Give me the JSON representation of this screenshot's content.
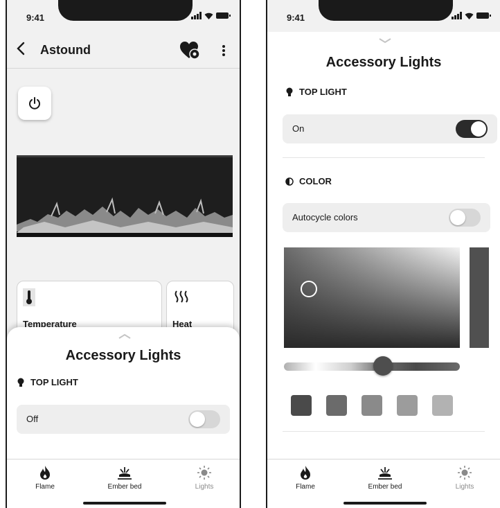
{
  "left_screen": {
    "status_time": "9:41",
    "device_name": "Astound",
    "cards": [
      {
        "label": "Temperature",
        "icon": "thermometer-icon"
      },
      {
        "label": "Heat",
        "icon": "heat-waves-icon"
      }
    ],
    "sheet": {
      "title": "Accessory Lights",
      "top_light_section": "TOP LIGHT",
      "top_light_row_label": "Off",
      "top_light_on": false
    }
  },
  "right_screen": {
    "status_time": "9:41",
    "title": "Accessory Lights",
    "top_light_section": "TOP LIGHT",
    "top_light_row_label": "On",
    "top_light_on": true,
    "color_section": "COLOR",
    "autocycle_label": "Autocycle colors",
    "autocycle_on": false,
    "preset_swatch_colors": [
      "#4a4a4a",
      "#6b6b6b",
      "#8a8a8a",
      "#9c9c9c",
      "#b2b2b2"
    ]
  },
  "tab_bar": {
    "tabs": [
      {
        "label": "Flame",
        "icon": "flame-icon"
      },
      {
        "label": "Ember bed",
        "icon": "ember-bed-icon"
      },
      {
        "label": "Lights",
        "icon": "sun-icon"
      }
    ]
  },
  "colors": {
    "background": "#f1f1f1",
    "surface": "#ffffff",
    "row": "#eeeeee",
    "toggle_on": "#2b2b2b",
    "toggle_off": "#d7d7d7"
  }
}
